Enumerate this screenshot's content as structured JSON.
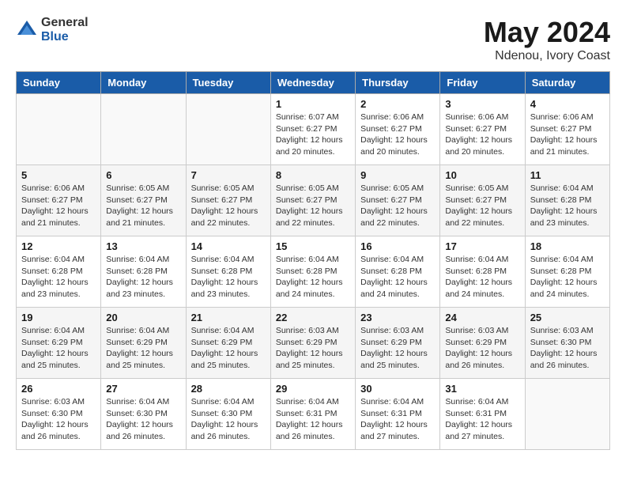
{
  "logo": {
    "general": "General",
    "blue": "Blue"
  },
  "title": "May 2024",
  "location": "Ndenou, Ivory Coast",
  "days_header": [
    "Sunday",
    "Monday",
    "Tuesday",
    "Wednesday",
    "Thursday",
    "Friday",
    "Saturday"
  ],
  "weeks": [
    [
      {
        "day": "",
        "info": ""
      },
      {
        "day": "",
        "info": ""
      },
      {
        "day": "",
        "info": ""
      },
      {
        "day": "1",
        "info": "Sunrise: 6:07 AM\nSunset: 6:27 PM\nDaylight: 12 hours\nand 20 minutes."
      },
      {
        "day": "2",
        "info": "Sunrise: 6:06 AM\nSunset: 6:27 PM\nDaylight: 12 hours\nand 20 minutes."
      },
      {
        "day": "3",
        "info": "Sunrise: 6:06 AM\nSunset: 6:27 PM\nDaylight: 12 hours\nand 20 minutes."
      },
      {
        "day": "4",
        "info": "Sunrise: 6:06 AM\nSunset: 6:27 PM\nDaylight: 12 hours\nand 21 minutes."
      }
    ],
    [
      {
        "day": "5",
        "info": "Sunrise: 6:06 AM\nSunset: 6:27 PM\nDaylight: 12 hours\nand 21 minutes."
      },
      {
        "day": "6",
        "info": "Sunrise: 6:05 AM\nSunset: 6:27 PM\nDaylight: 12 hours\nand 21 minutes."
      },
      {
        "day": "7",
        "info": "Sunrise: 6:05 AM\nSunset: 6:27 PM\nDaylight: 12 hours\nand 22 minutes."
      },
      {
        "day": "8",
        "info": "Sunrise: 6:05 AM\nSunset: 6:27 PM\nDaylight: 12 hours\nand 22 minutes."
      },
      {
        "day": "9",
        "info": "Sunrise: 6:05 AM\nSunset: 6:27 PM\nDaylight: 12 hours\nand 22 minutes."
      },
      {
        "day": "10",
        "info": "Sunrise: 6:05 AM\nSunset: 6:27 PM\nDaylight: 12 hours\nand 22 minutes."
      },
      {
        "day": "11",
        "info": "Sunrise: 6:04 AM\nSunset: 6:28 PM\nDaylight: 12 hours\nand 23 minutes."
      }
    ],
    [
      {
        "day": "12",
        "info": "Sunrise: 6:04 AM\nSunset: 6:28 PM\nDaylight: 12 hours\nand 23 minutes."
      },
      {
        "day": "13",
        "info": "Sunrise: 6:04 AM\nSunset: 6:28 PM\nDaylight: 12 hours\nand 23 minutes."
      },
      {
        "day": "14",
        "info": "Sunrise: 6:04 AM\nSunset: 6:28 PM\nDaylight: 12 hours\nand 23 minutes."
      },
      {
        "day": "15",
        "info": "Sunrise: 6:04 AM\nSunset: 6:28 PM\nDaylight: 12 hours\nand 24 minutes."
      },
      {
        "day": "16",
        "info": "Sunrise: 6:04 AM\nSunset: 6:28 PM\nDaylight: 12 hours\nand 24 minutes."
      },
      {
        "day": "17",
        "info": "Sunrise: 6:04 AM\nSunset: 6:28 PM\nDaylight: 12 hours\nand 24 minutes."
      },
      {
        "day": "18",
        "info": "Sunrise: 6:04 AM\nSunset: 6:28 PM\nDaylight: 12 hours\nand 24 minutes."
      }
    ],
    [
      {
        "day": "19",
        "info": "Sunrise: 6:04 AM\nSunset: 6:29 PM\nDaylight: 12 hours\nand 25 minutes."
      },
      {
        "day": "20",
        "info": "Sunrise: 6:04 AM\nSunset: 6:29 PM\nDaylight: 12 hours\nand 25 minutes."
      },
      {
        "day": "21",
        "info": "Sunrise: 6:04 AM\nSunset: 6:29 PM\nDaylight: 12 hours\nand 25 minutes."
      },
      {
        "day": "22",
        "info": "Sunrise: 6:03 AM\nSunset: 6:29 PM\nDaylight: 12 hours\nand 25 minutes."
      },
      {
        "day": "23",
        "info": "Sunrise: 6:03 AM\nSunset: 6:29 PM\nDaylight: 12 hours\nand 25 minutes."
      },
      {
        "day": "24",
        "info": "Sunrise: 6:03 AM\nSunset: 6:29 PM\nDaylight: 12 hours\nand 26 minutes."
      },
      {
        "day": "25",
        "info": "Sunrise: 6:03 AM\nSunset: 6:30 PM\nDaylight: 12 hours\nand 26 minutes."
      }
    ],
    [
      {
        "day": "26",
        "info": "Sunrise: 6:03 AM\nSunset: 6:30 PM\nDaylight: 12 hours\nand 26 minutes."
      },
      {
        "day": "27",
        "info": "Sunrise: 6:04 AM\nSunset: 6:30 PM\nDaylight: 12 hours\nand 26 minutes."
      },
      {
        "day": "28",
        "info": "Sunrise: 6:04 AM\nSunset: 6:30 PM\nDaylight: 12 hours\nand 26 minutes."
      },
      {
        "day": "29",
        "info": "Sunrise: 6:04 AM\nSunset: 6:31 PM\nDaylight: 12 hours\nand 26 minutes."
      },
      {
        "day": "30",
        "info": "Sunrise: 6:04 AM\nSunset: 6:31 PM\nDaylight: 12 hours\nand 27 minutes."
      },
      {
        "day": "31",
        "info": "Sunrise: 6:04 AM\nSunset: 6:31 PM\nDaylight: 12 hours\nand 27 minutes."
      },
      {
        "day": "",
        "info": ""
      }
    ]
  ]
}
